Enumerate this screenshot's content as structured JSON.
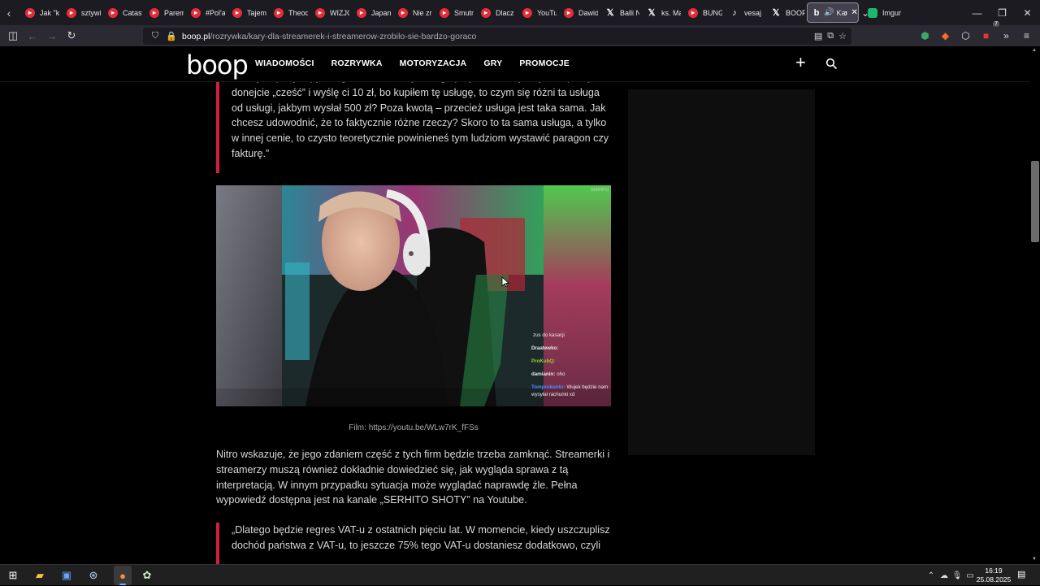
{
  "browser": {
    "tabs": [
      {
        "title": "Jak \"k",
        "icon": "youtube"
      },
      {
        "title": "sztywi",
        "icon": "youtube"
      },
      {
        "title": "Catast",
        "icon": "youtube"
      },
      {
        "title": "Parem",
        "icon": "youtube"
      },
      {
        "title": "#Pol'a",
        "icon": "youtube"
      },
      {
        "title": "Tajem",
        "icon": "youtube"
      },
      {
        "title": "Theod",
        "icon": "youtube"
      },
      {
        "title": "WIZJO",
        "icon": "youtube"
      },
      {
        "title": "Japan",
        "icon": "youtube"
      },
      {
        "title": "Nie zr",
        "icon": "youtube"
      },
      {
        "title": "Smutr",
        "icon": "youtube"
      },
      {
        "title": "Dlacz",
        "icon": "youtube"
      },
      {
        "title": "YouTu",
        "icon": "youtube"
      },
      {
        "title": "Dawid",
        "icon": "youtube"
      },
      {
        "title": "Balli N",
        "icon": "x"
      },
      {
        "title": "ks. Ma",
        "icon": "x"
      },
      {
        "title": "BUNG",
        "icon": "youtube"
      },
      {
        "title": "vesaj",
        "icon": "tiktok"
      },
      {
        "title": "BOOP",
        "icon": "x"
      }
    ],
    "active_tab": {
      "title": "Kar",
      "icon": "boop"
    },
    "after_tab": {
      "title": "Imgur",
      "icon": "imgur"
    },
    "url_domain": "boop.pl",
    "url_path": "/rozrywka/kary-dla-streamerek-i-streamerow-zrobilo-sie-bardzo-goraco"
  },
  "site": {
    "logo": "boop",
    "nav": [
      "WIADOMOŚCI",
      "ROZRYWKA",
      "MOTORYZACJA",
      "GRY",
      "PROMOCJE"
    ]
  },
  "article": {
    "quote1": "„Tam jest parę zapytań, gdzie można się do tego przywołać. Czyli – jeśli wpiszę w donejcie „cześć” i wyślę ci 10 zł, bo kupiłem tę usługę, to czym się różni ta usługa od usługi, jakbym wysłał 500 zł? Poza kwotą – przecież usługa jest taka sama. Jak chcesz udowodnić, że to faktycznie różne rzeczy? Skoro to ta sama usługa, a tylko w innej cenie, to czysto teoretycznie powinieneś tym ludziom wystawić paragon czy fakturę.”",
    "video_chat": [
      {
        "user": "",
        "text": "zus do kasacji",
        "user_color": "#c08cff"
      },
      {
        "user": "Draatewko:",
        "text": "",
        "user_color": "#e8e8e8"
      },
      {
        "user": "ProKubQ:",
        "text": "",
        "user_color": "#9acd32"
      },
      {
        "user": "damianin:",
        "text": "oho",
        "user_color": "#e8e8e8"
      },
      {
        "user": "Tomprokonto:",
        "text": "Wujek będzie nam wysyłał rachunki xd",
        "user_color": "#4b8cff"
      }
    ],
    "video_watermark": "SERHITO",
    "caption": "Film: https://youtu.be/WLw7rK_fFSs",
    "paragraph": "Nitro wskazuje, że jego zdaniem część z tych firm będzie trzeba zamknąć. Streamerki i streamerzy muszą również dokładnie dowiedzieć się, jak wygląda sprawa z tą interpretacją. W innym przypadku sytuacja może wyglądać naprawdę źle. Pełna wypowiedź dostępna jest na kanale „SERHITO SHOTY” na Youtube.",
    "quote2": "„Dlatego będzie regres VAT-u z ostatnich pięciu lat. W momencie, kiedy uszczuplisz dochód państwa z VAT-u, to jeszcze 75% tego VAT-u dostaniesz dodatkowo, czyli"
  },
  "taskbar": {
    "time": "16:19",
    "date": "25.08.2025"
  },
  "colors": {
    "accent_red": "#d01f3c",
    "browser_bg": "#1c1b22",
    "toolbar_bg": "#2b2a33"
  }
}
